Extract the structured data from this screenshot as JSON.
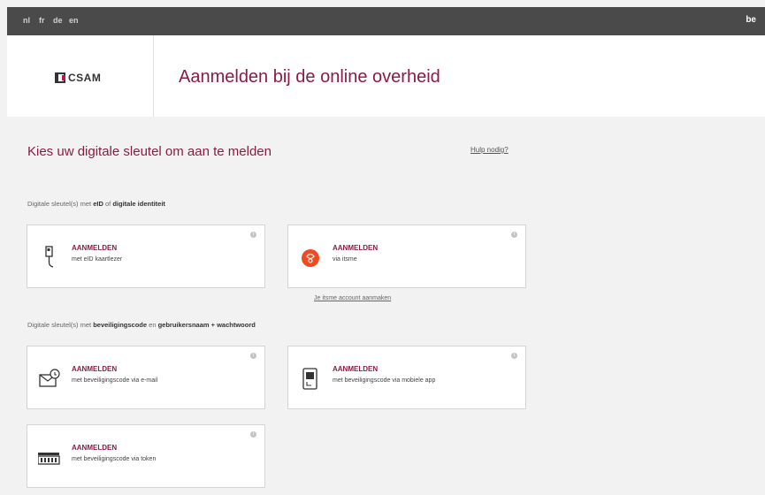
{
  "topbar": {
    "languages": [
      "nl",
      "fr",
      "de",
      "en"
    ],
    "country_code": "be"
  },
  "header": {
    "logo_text": "CSAM",
    "title": "Aanmelden bij de online overheid"
  },
  "main": {
    "title": "Kies uw digitale sleutel om aan te melden",
    "help_link": "Hulp nodig?",
    "group1": {
      "prefix": "Digitale sleutel(s) met",
      "key1": "eID",
      "middle": "of",
      "key2": "digitale identiteit"
    },
    "group2": {
      "prefix": "Digitale sleutel(s) met",
      "key1": "beveiligingscode",
      "middle": "en",
      "key2": "gebruikersnaam + wachtwoord"
    },
    "cards": [
      {
        "title": "AANMELDEN",
        "subtitle": "met eID kaartlezer",
        "icon": "card-reader-icon"
      },
      {
        "title": "AANMELDEN",
        "subtitle": "via itsme",
        "icon": "itsme-icon"
      },
      {
        "title": "AANMELDEN",
        "subtitle": "met beveiligingscode via e-mail",
        "icon": "email-icon"
      },
      {
        "title": "AANMELDEN",
        "subtitle": "met beveiligingscode via mobiele app",
        "icon": "mobile-app-icon"
      },
      {
        "title": "AANMELDEN",
        "subtitle": "met beveiligingscode via token",
        "icon": "token-icon"
      }
    ],
    "itsme_account_link": "Je itsme account aanmaken"
  },
  "colors": {
    "accent": "#8a1c44",
    "itsme": "#ef4b23",
    "topbar": "#4a4a4a"
  }
}
